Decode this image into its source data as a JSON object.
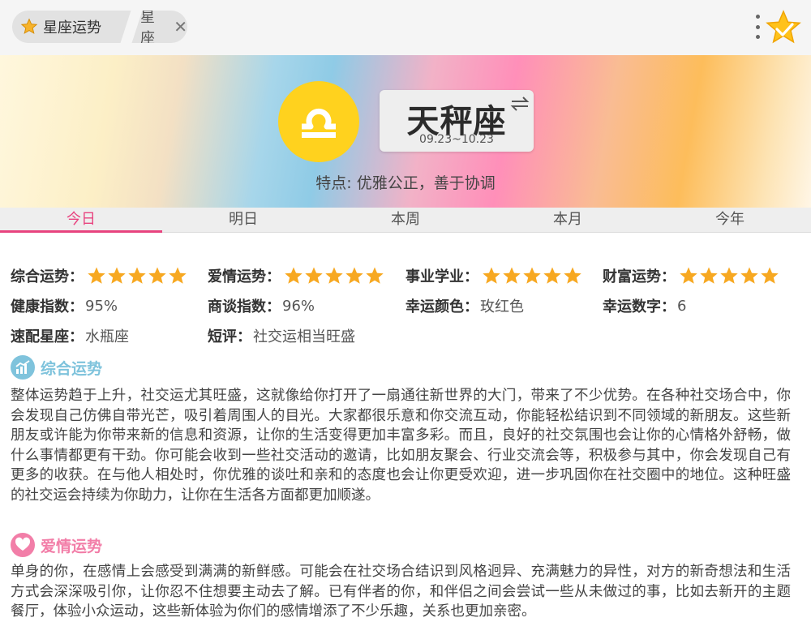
{
  "breadcrumb": {
    "main_label": "星座运势",
    "sub_label": "星座"
  },
  "icons": {
    "star": "star-icon",
    "close": "close-icon",
    "more": "more-vertical-icon",
    "favorite": "favorite-star-icon",
    "libra": "libra-symbol-icon",
    "swap": "swap-icon",
    "chart": "chart-icon",
    "heart": "heart-icon"
  },
  "colors": {
    "accent": "#e8437f",
    "star": "#f7a821",
    "sign_circle": "#ffd21e",
    "general_section": "#7fc3dc",
    "love_section": "#f27ea8"
  },
  "sign": {
    "name": "天秤座",
    "date_range": "09.23~10.23",
    "trait": "特点: 优雅公正，善于协调"
  },
  "tabs": [
    "今日",
    "明日",
    "本周",
    "本月",
    "今年"
  ],
  "active_tab": 0,
  "ratings": [
    {
      "label": "综合运势：",
      "stars": 5
    },
    {
      "label": "爱情运势：",
      "stars": 5
    },
    {
      "label": "事业学业：",
      "stars": 5
    },
    {
      "label": "财富运势：",
      "stars": 5
    }
  ],
  "indices": [
    {
      "label": "健康指数：",
      "value": "95%"
    },
    {
      "label": "商谈指数：",
      "value": "96%"
    },
    {
      "label": "幸运颜色：",
      "value": "玫红色"
    },
    {
      "label": "幸运数字：",
      "value": "6"
    }
  ],
  "extra": [
    {
      "label": "速配星座：",
      "value": "水瓶座"
    },
    {
      "label": "短评：",
      "value": "社交运相当旺盛"
    }
  ],
  "sections": {
    "general": {
      "title": "综合运势",
      "text": "整体运势趋于上升，社交运尤其旺盛，这就像给你打开了一扇通往新世界的大门，带来了不少优势。在各种社交场合中，你会发现自己仿佛自带光芒，吸引着周围人的目光。大家都很乐意和你交流互动，你能轻松结识到不同领域的新朋友。这些新朋友或许能为你带来新的信息和资源，让你的生活变得更加丰富多彩。而且，良好的社交氛围也会让你的心情格外舒畅，做什么事情都更有干劲。你可能会收到一些社交活动的邀请，比如朋友聚会、行业交流会等，积极参与其中，你会发现自己有更多的收获。在与他人相处时，你优雅的谈吐和亲和的态度也会让你更受欢迎，进一步巩固你在社交圈中的地位。这种旺盛的社交运会持续为你助力，让你在生活各方面都更加顺遂。"
    },
    "love": {
      "title": "爱情运势",
      "text": "单身的你，在感情上会感受到满满的新鲜感。可能会在社交场合结识到风格迥异、充满魅力的异性，对方的新奇想法和生活方式会深深吸引你，让你忍不住想要主动去了解。已有伴者的你，和伴侣之间会尝试一些从未做过的事，比如去新开的主题餐厅，体验小众运动，这些新体验为你们的感情增添了不少乐趣，关系也更加亲密。"
    }
  }
}
